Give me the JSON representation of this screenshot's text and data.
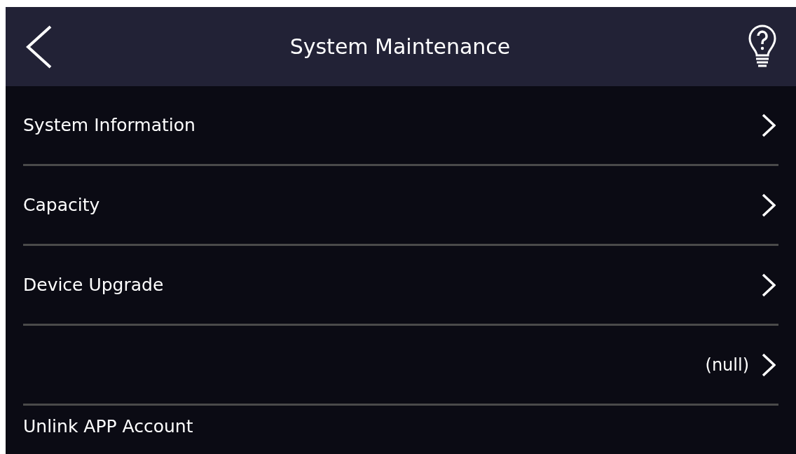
{
  "header": {
    "title": "System Maintenance"
  },
  "items": [
    {
      "label": "System Information",
      "arrow": true
    },
    {
      "label": "Capacity",
      "arrow": true
    },
    {
      "label": "Device Upgrade",
      "arrow": true
    },
    {
      "value": "(null)",
      "arrow": true
    },
    {
      "label": "Unlink APP Account",
      "arrow": false
    }
  ]
}
